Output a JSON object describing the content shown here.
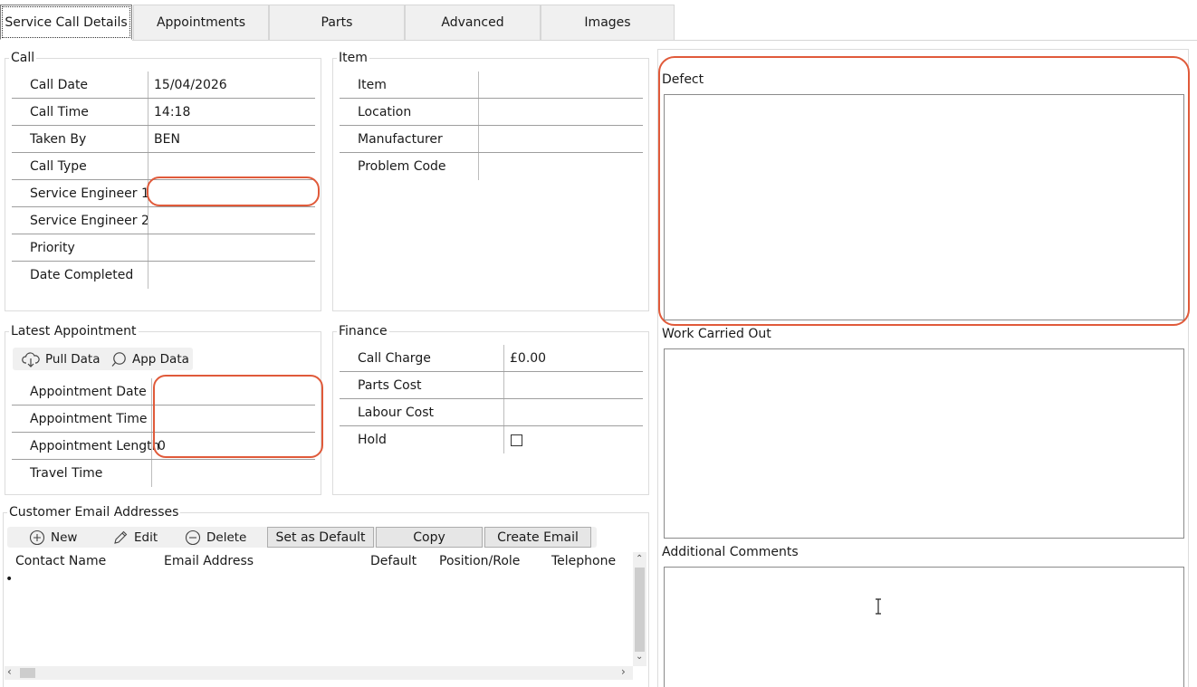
{
  "tabs": [
    {
      "label": "Service Call Details",
      "active": true
    },
    {
      "label": "Appointments",
      "active": false
    },
    {
      "label": "Parts",
      "active": false
    },
    {
      "label": "Advanced",
      "active": false
    },
    {
      "label": "Images",
      "active": false
    }
  ],
  "call": {
    "title": "Call",
    "rows": [
      {
        "label": "Call Date",
        "value": "15/04/2026"
      },
      {
        "label": "Call Time",
        "value": "14:18"
      },
      {
        "label": "Taken By",
        "value": "BEN"
      },
      {
        "label": "Call Type",
        "value": ""
      },
      {
        "label": "Service Engineer 1",
        "value": ""
      },
      {
        "label": "Service Engineer 2",
        "value": ""
      },
      {
        "label": "Priority",
        "value": ""
      },
      {
        "label": "Date Completed",
        "value": ""
      }
    ]
  },
  "item": {
    "title": "Item",
    "rows": [
      {
        "label": "Item",
        "value": ""
      },
      {
        "label": "Location",
        "value": ""
      },
      {
        "label": "Manufacturer",
        "value": ""
      },
      {
        "label": "Problem Code",
        "value": ""
      }
    ]
  },
  "latest_appointment": {
    "title": "Latest Appointment",
    "pull_data_label": "Pull Data",
    "app_data_label": "App Data",
    "rows": [
      {
        "label": "Appointment Date",
        "value": ""
      },
      {
        "label": "Appointment Time",
        "value": ""
      },
      {
        "label": "Appointment Length",
        "value": "0"
      },
      {
        "label": "Travel Time",
        "value": ""
      }
    ]
  },
  "finance": {
    "title": "Finance",
    "rows": [
      {
        "label": "Call Charge",
        "value": "£0.00"
      },
      {
        "label": "Parts Cost",
        "value": ""
      },
      {
        "label": "Labour Cost",
        "value": ""
      },
      {
        "label": "Hold",
        "value": "",
        "checked": false
      }
    ]
  },
  "customer_emails": {
    "title": "Customer Email Addresses",
    "toolbar": {
      "new_label": "New",
      "edit_label": "Edit",
      "delete_label": "Delete",
      "set_default_label": "Set as Default",
      "copy_label": "Copy",
      "create_email_label": "Create Email"
    },
    "columns": [
      "Contact Name",
      "Email Address",
      "Default",
      "Position/Role",
      "Telephone"
    ],
    "row_marker": "•"
  },
  "notes": {
    "defect_label": "Defect",
    "defect_value": "",
    "work_label": "Work Carried Out",
    "work_value": "",
    "comments_label": "Additional Comments",
    "comments_value": ""
  },
  "colors": {
    "highlight": "#e05a3a",
    "tab_bg": "#f0f0f0",
    "border": "#dcdcdc"
  }
}
